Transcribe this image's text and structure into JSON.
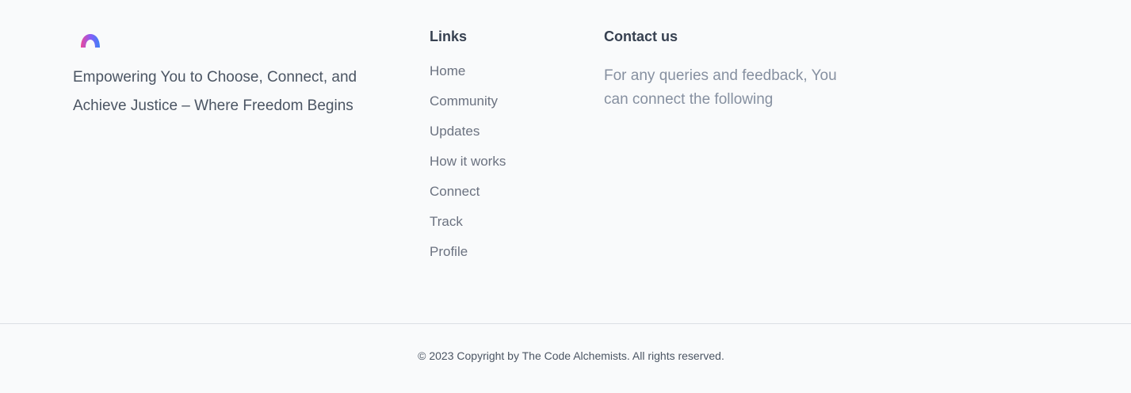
{
  "brand": {
    "logo_icon": "rainbow-arch-logo-icon",
    "tagline": "Empowering You to Choose, Connect, and Achieve Justice – Where Freedom Begins",
    "logo_colors": [
      "#ec4899",
      "#8b5cf6",
      "#3b82f6"
    ]
  },
  "links": {
    "heading": "Links",
    "items": [
      {
        "label": "Home"
      },
      {
        "label": "Community"
      },
      {
        "label": "Updates"
      },
      {
        "label": "How it works"
      },
      {
        "label": "Connect"
      },
      {
        "label": "Track"
      },
      {
        "label": "Profile"
      }
    ]
  },
  "contact": {
    "heading": "Contact us",
    "text": "For any queries and feedback, You can connect the following"
  },
  "copyright": "© 2023 Copyright by The Code Alchemists. All rights reserved.",
  "colors": {
    "background": "#f9fafb",
    "heading": "#374151",
    "link": "#6b7280",
    "body_text": "#4b5563",
    "divider": "#dcdfe4"
  }
}
